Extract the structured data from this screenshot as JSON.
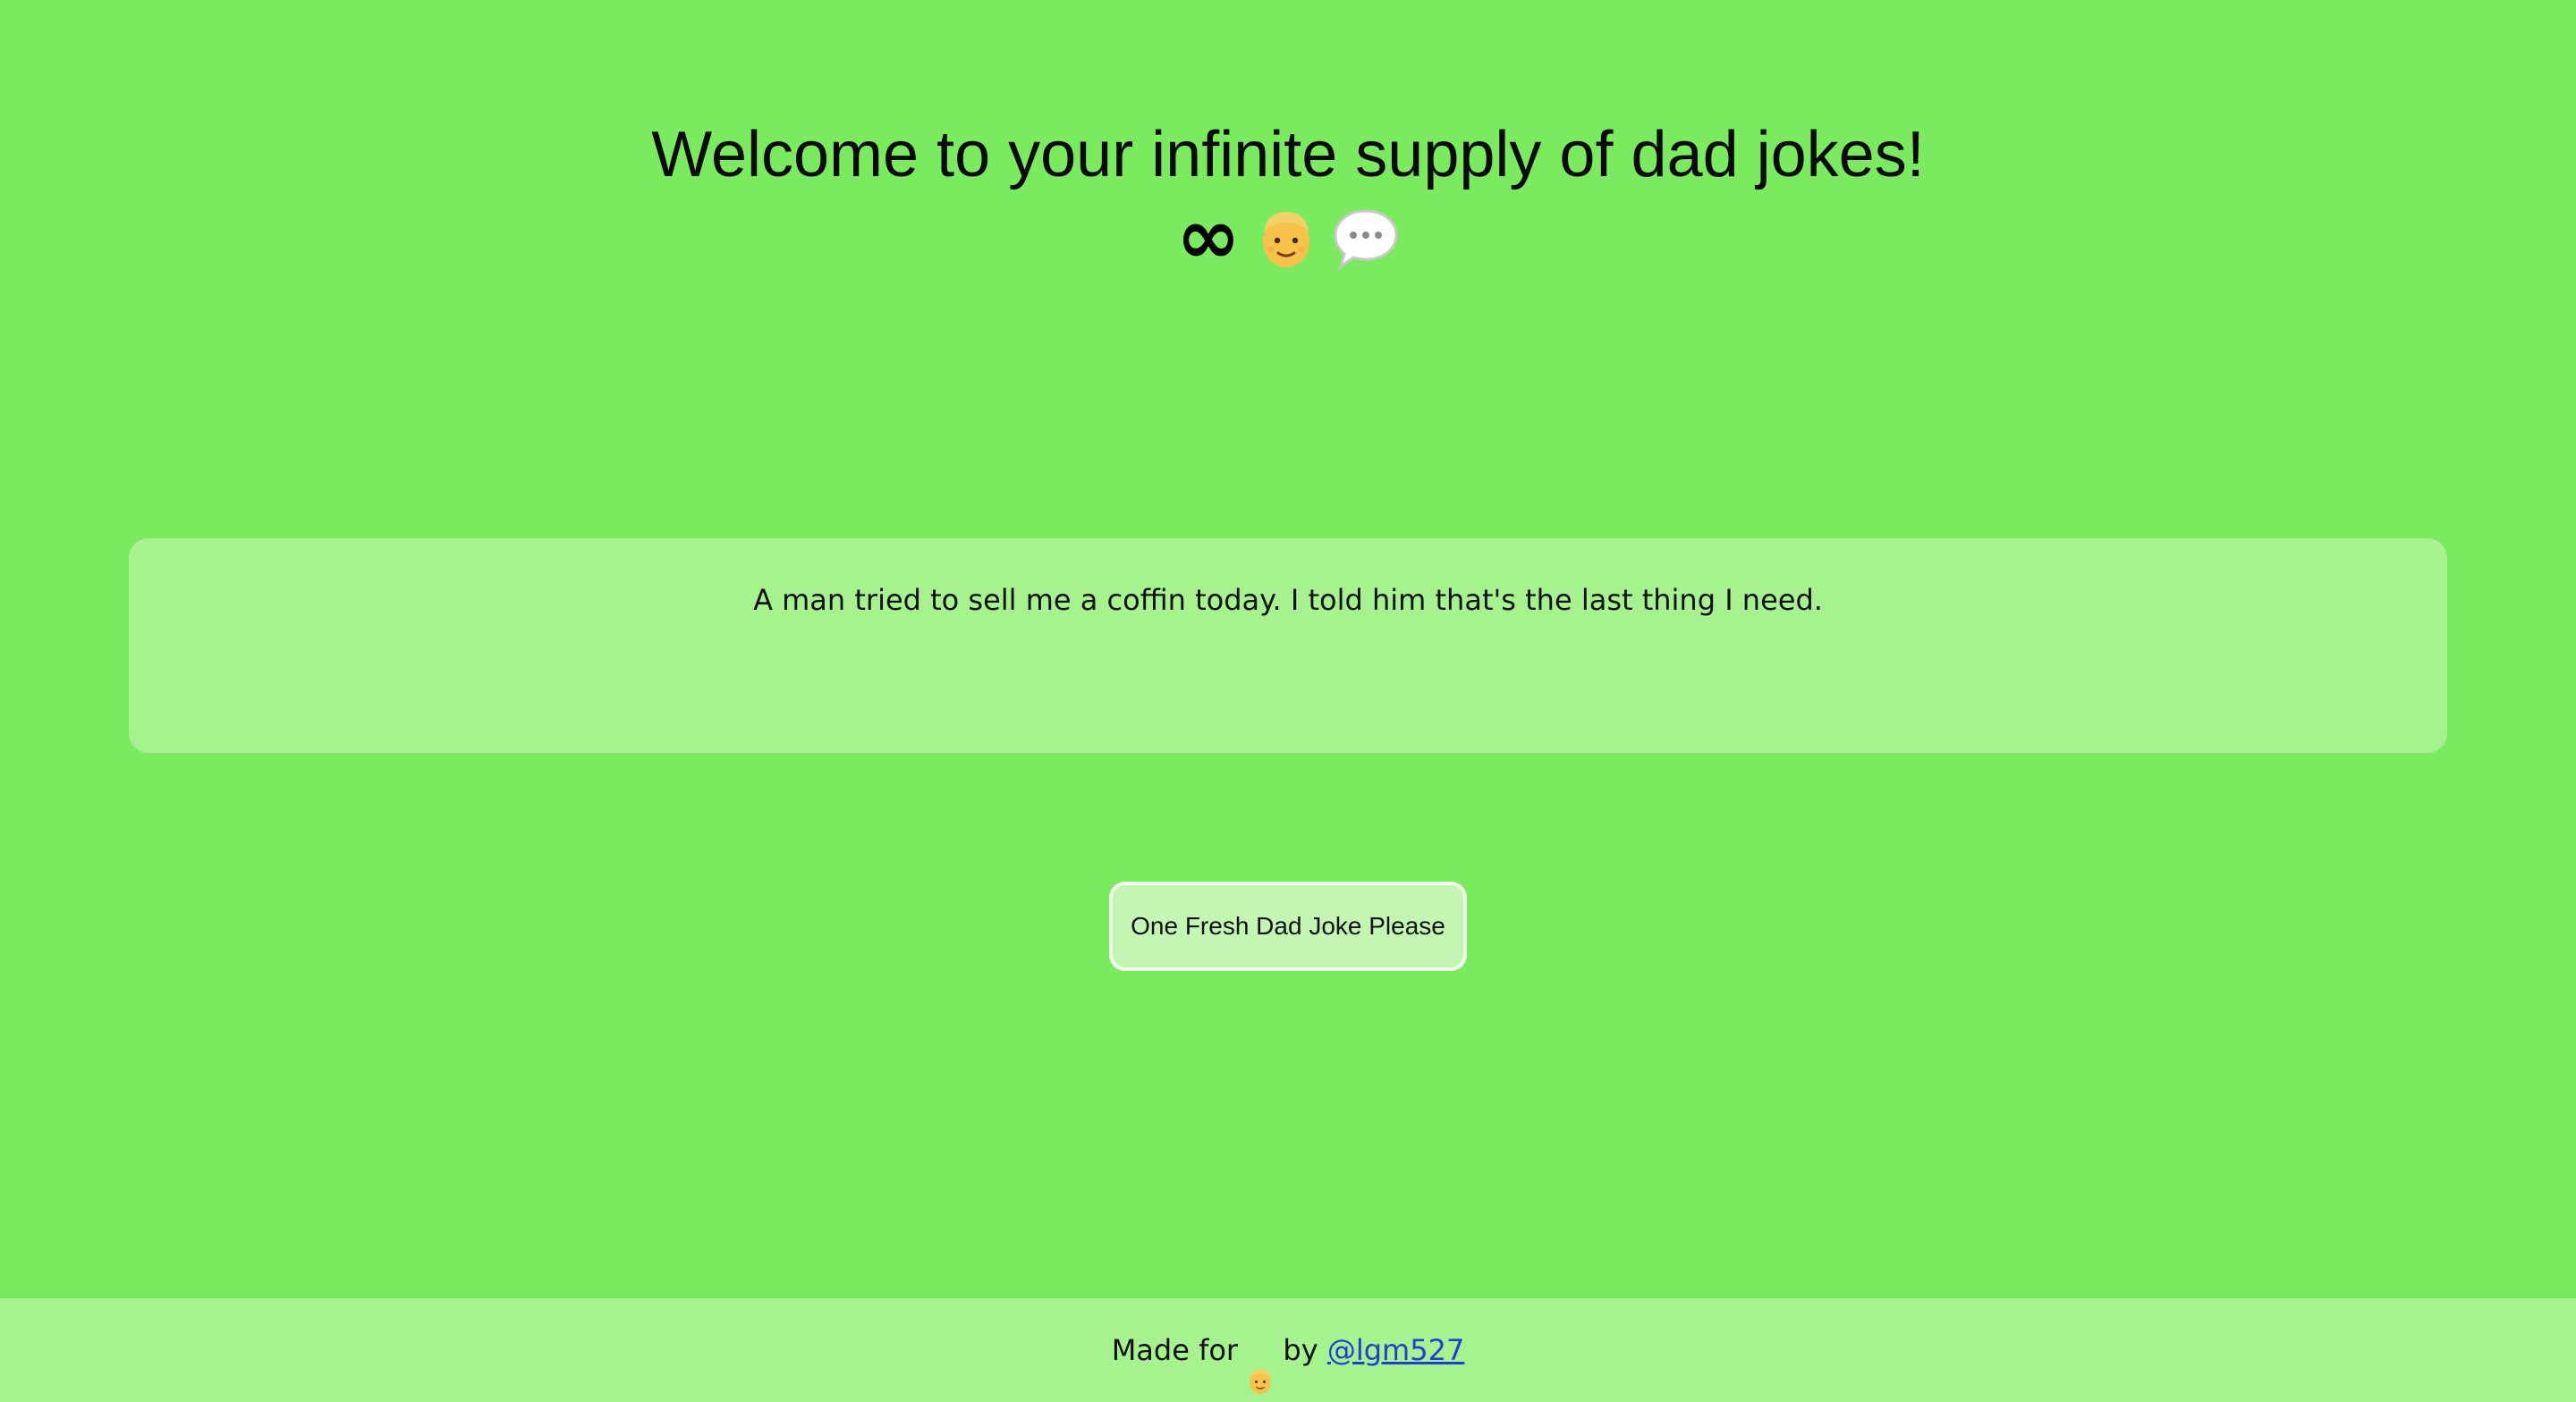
{
  "header": {
    "title": "Welcome to your infinite supply of dad jokes!",
    "infinity_symbol": "∞",
    "icons": [
      "dad-face-icon",
      "speech-bubble-icon"
    ]
  },
  "joke": {
    "text": "A man tried to sell me a coffin today. I told him that's the last thing I need."
  },
  "button": {
    "label": "One Fresh Dad Joke Please"
  },
  "footer": {
    "prefix": "Made for",
    "by": "by",
    "link_text": "@lgm527"
  },
  "colors": {
    "background": "#7aeb5f",
    "card": "#a6f28f",
    "button": "#c2f6b2",
    "link": "#1f3fd6"
  }
}
